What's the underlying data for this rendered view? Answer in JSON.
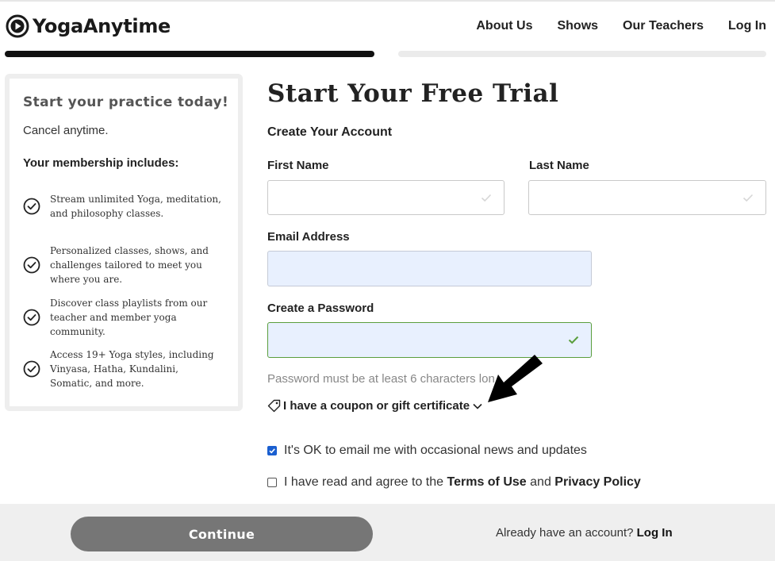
{
  "header": {
    "logo_text": "YogaAnytime",
    "nav": [
      "About Us",
      "Shows",
      "Our Teachers",
      "Log In"
    ]
  },
  "progress": {
    "step": 1,
    "total_steps": 2
  },
  "panel": {
    "title": "Start your practice today!",
    "cancel": "Cancel anytime.",
    "includes_heading": "Your membership includes:",
    "benefits": [
      "Stream unlimited Yoga, meditation, and philosophy classes.",
      "Personalized classes, shows, and challenges tailored to meet you where you are.",
      "Discover class playlists from our teacher and member yoga community.",
      "Access 19+ Yoga styles, including Vinyasa, Hatha, Kundalini, Somatic, and more."
    ]
  },
  "form": {
    "title": "Start Your Free Trial",
    "subtitle": "Create Your Account",
    "first_name_label": "First Name",
    "first_name_value": "",
    "last_name_label": "Last Name",
    "last_name_value": "",
    "email_label": "Email Address",
    "email_value": "",
    "password_label": "Create a Password",
    "password_value": "",
    "password_hint": "Password must be at least 6 characters lon",
    "coupon_label": "I have a coupon or gift certificate",
    "email_optin": {
      "checked": true,
      "text": "It's OK to email me with occasional news and updates"
    },
    "terms": {
      "checked": false,
      "prefix": "I have read and agree to the",
      "terms_link": "Terms of Use",
      "and": "and",
      "privacy_link": "Privacy Policy"
    }
  },
  "footer": {
    "continue_label": "Continue",
    "already_text": "Already have an account?",
    "login_link": "Log In"
  },
  "colors": {
    "accent_valid": "#5a9e3d",
    "autofill_bg": "#e8f0fe",
    "checkbox_blue": "#1a5fd0",
    "button_gray": "#767676"
  },
  "icons": [
    "logo-play-icon",
    "check-circle-icon",
    "field-check-icon",
    "tag-icon",
    "chevron-down-icon",
    "pointer-arrow-icon"
  ]
}
